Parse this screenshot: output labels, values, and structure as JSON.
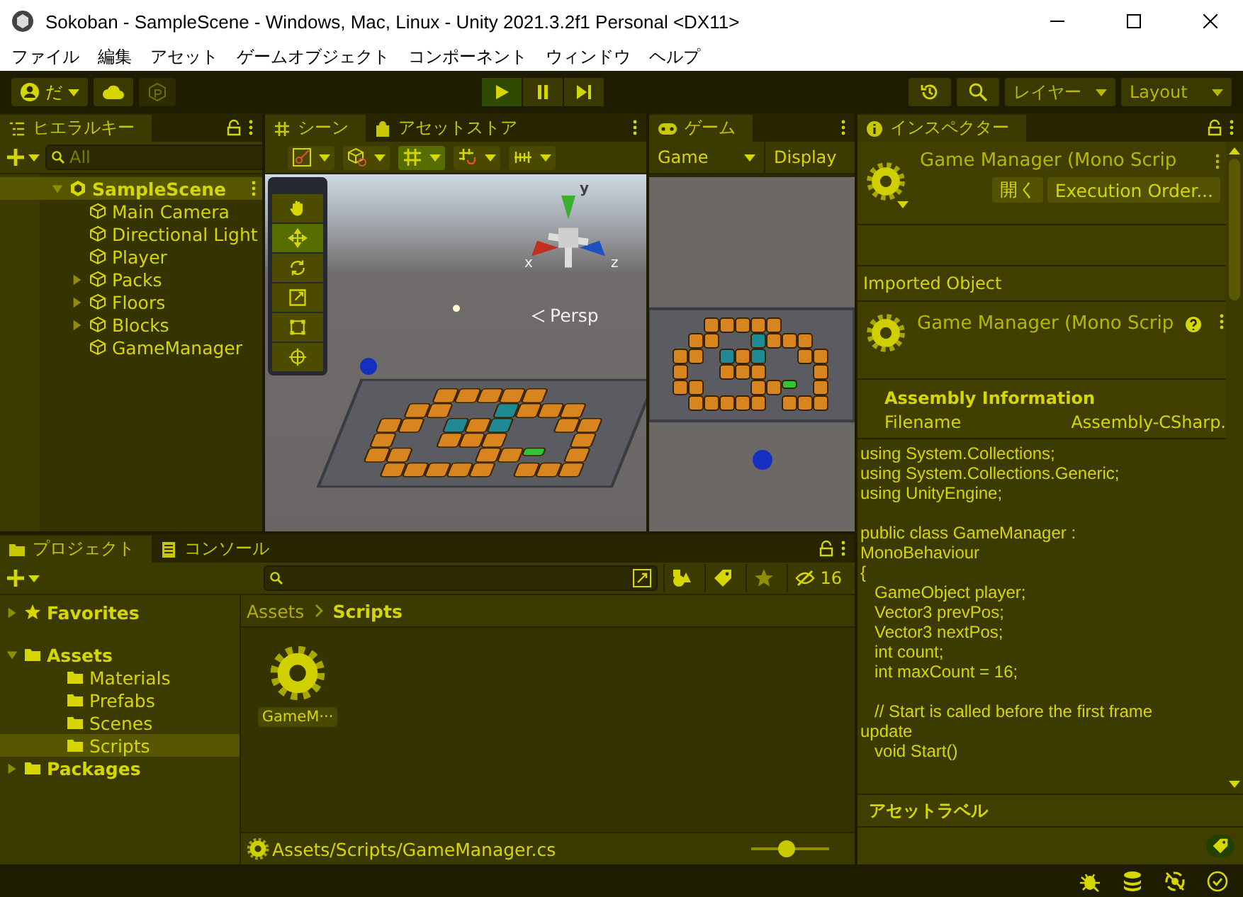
{
  "window": {
    "title": "Sokoban - SampleScene - Windows, Mac, Linux - Unity 2021.3.2f1 Personal <DX11>"
  },
  "menu": [
    "ファイル",
    "編集",
    "アセット",
    "ゲームオブジェクト",
    "コンポーネント",
    "ウィンドウ",
    "ヘルプ"
  ],
  "toolbar": {
    "account": "だ",
    "layers": "レイヤー",
    "layout": "Layout"
  },
  "hierarchy": {
    "tab": "ヒエラルキー",
    "search_placeholder": "All",
    "items": [
      {
        "label": "SampleScene",
        "kind": "scene",
        "expanded": true,
        "selected": true,
        "children": [
          {
            "label": "Main Camera",
            "kind": "object",
            "selected": false
          },
          {
            "label": "Directional Light",
            "kind": "object",
            "selected": false
          },
          {
            "label": "Player",
            "kind": "object",
            "selected": false
          },
          {
            "label": "Packs",
            "kind": "group",
            "expanded": false,
            "selected": false
          },
          {
            "label": "Floors",
            "kind": "group",
            "expanded": false,
            "selected": false
          },
          {
            "label": "Blocks",
            "kind": "group",
            "expanded": false,
            "selected": false
          },
          {
            "label": "GameManager",
            "kind": "object",
            "selected": false
          }
        ]
      }
    ]
  },
  "scene": {
    "tabs": [
      {
        "label": "シーン",
        "selected": true
      },
      {
        "label": "アセットストア",
        "selected": false
      }
    ],
    "tools": [
      {
        "kind": "hand",
        "selected": false
      },
      {
        "kind": "move",
        "selected": true
      },
      {
        "kind": "rotate",
        "selected": false
      },
      {
        "kind": "scale",
        "selected": false
      },
      {
        "kind": "rect",
        "selected": false
      },
      {
        "kind": "transform",
        "selected": false
      }
    ],
    "axes": [
      "x",
      "y",
      "z"
    ],
    "projection": "Persp"
  },
  "game": {
    "tab": "ゲーム",
    "view": "Game",
    "display": "Display"
  },
  "inspector": {
    "tab": "インスペクター",
    "title": "Game Manager (Mono Scrip",
    "buttons": [
      "開く",
      "Execution Order..."
    ],
    "imported_label": "Imported Object",
    "imported_title": "Game Manager (Mono Scrip",
    "assembly": {
      "heading": "Assembly Information",
      "key": "Filename",
      "value": "Assembly-CSharp."
    },
    "code": [
      [
        "using System.Collections;",
        "using System.Collections.Generic;",
        "using UnityEngine;"
      ],
      [
        "public class GameManager :",
        "MonoBehaviour",
        "{",
        "   GameObject player;",
        "   Vector3 prevPos;",
        "   Vector3 nextPos;",
        "   int count;",
        "   int maxCount = 16;"
      ],
      [
        "   // Start is called before the first frame",
        "update",
        "   void Start()"
      ]
    ],
    "labels_heading": "アセットラベル"
  },
  "project": {
    "tabs": [
      {
        "label": "プロジェクト",
        "selected": true
      },
      {
        "label": "コンソール",
        "selected": false
      }
    ],
    "hidden_count": "16",
    "tree": [
      {
        "label": "Favorites",
        "kind": "favorites",
        "expanded": false,
        "selected": false
      },
      {
        "label": "Assets",
        "kind": "folder",
        "expanded": true,
        "selected": false,
        "children": [
          {
            "label": "Materials",
            "kind": "folder",
            "selected": false
          },
          {
            "label": "Prefabs",
            "kind": "folder",
            "selected": false
          },
          {
            "label": "Scenes",
            "kind": "folder",
            "selected": false
          },
          {
            "label": "Scripts",
            "kind": "folder",
            "selected": true
          }
        ]
      },
      {
        "label": "Packages",
        "kind": "folder",
        "expanded": false,
        "selected": false
      }
    ],
    "breadcrumb": [
      "Assets",
      "Scripts"
    ],
    "assets": [
      {
        "label": "GameM···",
        "selected": true
      }
    ],
    "path": "Assets/Scripts/GameManager.cs",
    "zoom": {
      "level": 0.45
    }
  }
}
